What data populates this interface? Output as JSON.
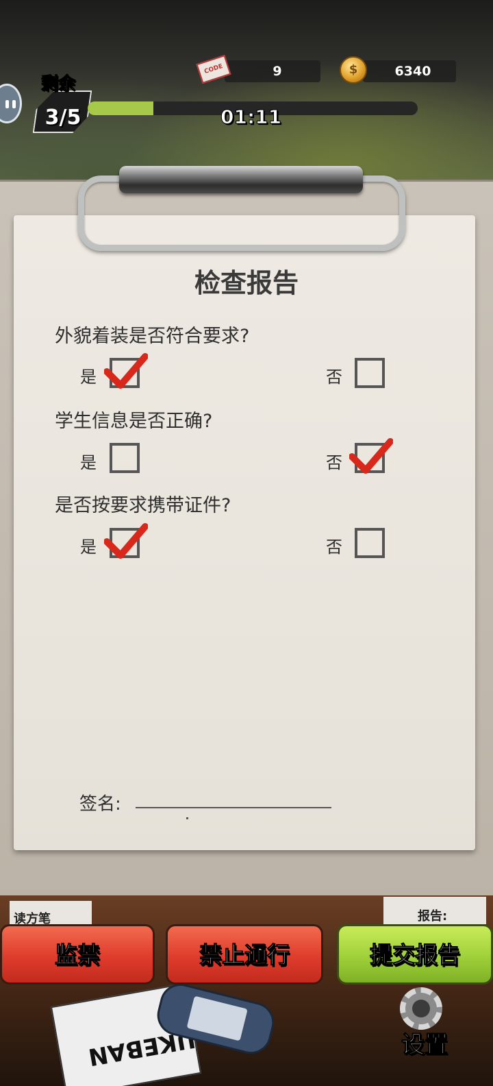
{
  "hud": {
    "remain_label": "剩余",
    "remain_count": "3/5",
    "progress_fraction": 0.2,
    "timer": "01:11",
    "code_count": "9",
    "code_icon_text": "CODE",
    "coins": "6340"
  },
  "report": {
    "title": "检查报告",
    "questions": [
      {
        "text": "外貌着装是否符合要求?",
        "yes_label": "是",
        "no_label": "否",
        "selected": "yes"
      },
      {
        "text": "学生信息是否正确?",
        "yes_label": "是",
        "no_label": "否",
        "selected": "no"
      },
      {
        "text": "是否按要求携带证件?",
        "yes_label": "是",
        "no_label": "否",
        "selected": "yes"
      }
    ],
    "signature_label": "签名:"
  },
  "desk": {
    "note_left": "读方笔",
    "note_right": "报告:",
    "comic_text": "SUKEBAN"
  },
  "actions": {
    "detain": "监禁",
    "deny": "禁止通行",
    "submit": "提交报告"
  },
  "settings": {
    "label": "设置"
  },
  "colors": {
    "check_red": "#d8281c",
    "progress_green": "#a6c94a",
    "button_red": "#df3c2c",
    "button_green": "#9fd03a"
  }
}
